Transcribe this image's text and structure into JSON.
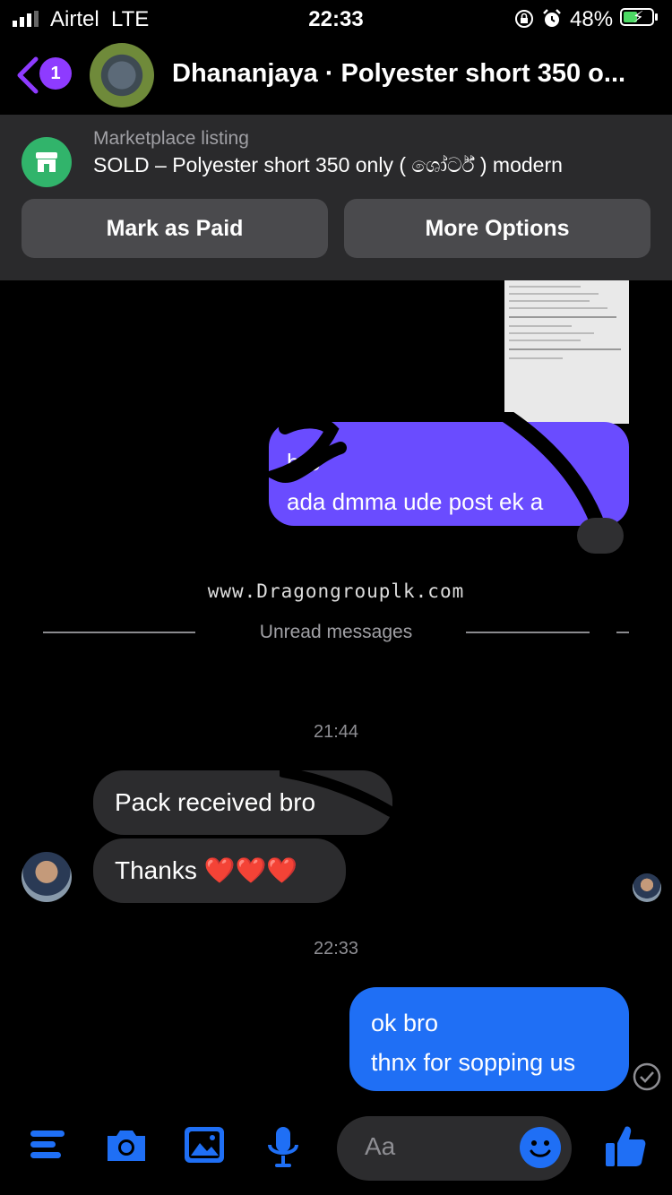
{
  "status_bar": {
    "carrier": "Airtel",
    "network": "LTE",
    "time": "22:33",
    "battery": "48%"
  },
  "header": {
    "unread_badge": "1",
    "title": "Dhananjaya · Polyester short 350 o..."
  },
  "marketplace": {
    "label": "Marketplace listing",
    "title": "SOLD – Polyester short 350 only ( ශෝර්ට් ) modern",
    "mark_paid_label": "Mark as Paid",
    "more_options_label": "More Options"
  },
  "messages": {
    "sent_purple_text": "bro\nada dmma ude post ek a",
    "watermark": "www.Dragongrouplk.com",
    "unread_label": "Unread messages",
    "time_1": "21:44",
    "received_1": "Pack received bro",
    "received_2": "Thanks ❤️❤️❤️",
    "time_2": "22:33",
    "sent_blue_text": "ok bro\nthnx for sopping us"
  },
  "composer": {
    "placeholder": "Aa"
  },
  "colors": {
    "accent_blue": "#1f6ff5",
    "purple_bubble": "#6a4cff",
    "badge_purple": "#8e3bff",
    "marketplace_green": "#31b46b"
  },
  "icons": [
    "back-chevron-icon",
    "marketplace-store-icon",
    "menu-icon",
    "camera-icon",
    "image-icon",
    "microphone-icon",
    "emoji-icon",
    "thumbs-up-icon",
    "seen-check-icon"
  ]
}
